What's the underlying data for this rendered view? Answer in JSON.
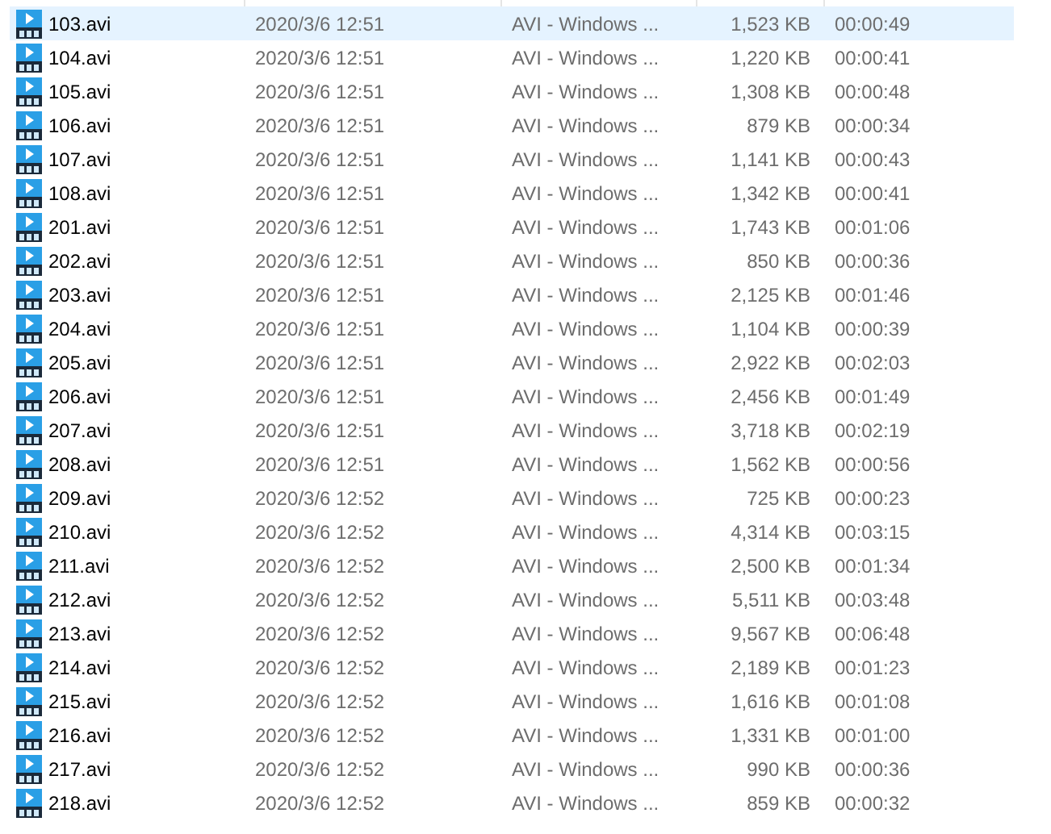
{
  "files": [
    {
      "name": "103.avi",
      "date": "2020/3/6 12:51",
      "type": "AVI - Windows ...",
      "size": "1,523 KB",
      "duration": "00:00:49",
      "selected": true
    },
    {
      "name": "104.avi",
      "date": "2020/3/6 12:51",
      "type": "AVI - Windows ...",
      "size": "1,220 KB",
      "duration": "00:00:41",
      "selected": false
    },
    {
      "name": "105.avi",
      "date": "2020/3/6 12:51",
      "type": "AVI - Windows ...",
      "size": "1,308 KB",
      "duration": "00:00:48",
      "selected": false
    },
    {
      "name": "106.avi",
      "date": "2020/3/6 12:51",
      "type": "AVI - Windows ...",
      "size": "879 KB",
      "duration": "00:00:34",
      "selected": false
    },
    {
      "name": "107.avi",
      "date": "2020/3/6 12:51",
      "type": "AVI - Windows ...",
      "size": "1,141 KB",
      "duration": "00:00:43",
      "selected": false
    },
    {
      "name": "108.avi",
      "date": "2020/3/6 12:51",
      "type": "AVI - Windows ...",
      "size": "1,342 KB",
      "duration": "00:00:41",
      "selected": false
    },
    {
      "name": "201.avi",
      "date": "2020/3/6 12:51",
      "type": "AVI - Windows ...",
      "size": "1,743 KB",
      "duration": "00:01:06",
      "selected": false
    },
    {
      "name": "202.avi",
      "date": "2020/3/6 12:51",
      "type": "AVI - Windows ...",
      "size": "850 KB",
      "duration": "00:00:36",
      "selected": false
    },
    {
      "name": "203.avi",
      "date": "2020/3/6 12:51",
      "type": "AVI - Windows ...",
      "size": "2,125 KB",
      "duration": "00:01:46",
      "selected": false
    },
    {
      "name": "204.avi",
      "date": "2020/3/6 12:51",
      "type": "AVI - Windows ...",
      "size": "1,104 KB",
      "duration": "00:00:39",
      "selected": false
    },
    {
      "name": "205.avi",
      "date": "2020/3/6 12:51",
      "type": "AVI - Windows ...",
      "size": "2,922 KB",
      "duration": "00:02:03",
      "selected": false
    },
    {
      "name": "206.avi",
      "date": "2020/3/6 12:51",
      "type": "AVI - Windows ...",
      "size": "2,456 KB",
      "duration": "00:01:49",
      "selected": false
    },
    {
      "name": "207.avi",
      "date": "2020/3/6 12:51",
      "type": "AVI - Windows ...",
      "size": "3,718 KB",
      "duration": "00:02:19",
      "selected": false
    },
    {
      "name": "208.avi",
      "date": "2020/3/6 12:51",
      "type": "AVI - Windows ...",
      "size": "1,562 KB",
      "duration": "00:00:56",
      "selected": false
    },
    {
      "name": "209.avi",
      "date": "2020/3/6 12:52",
      "type": "AVI - Windows ...",
      "size": "725 KB",
      "duration": "00:00:23",
      "selected": false
    },
    {
      "name": "210.avi",
      "date": "2020/3/6 12:52",
      "type": "AVI - Windows ...",
      "size": "4,314 KB",
      "duration": "00:03:15",
      "selected": false
    },
    {
      "name": "211.avi",
      "date": "2020/3/6 12:52",
      "type": "AVI - Windows ...",
      "size": "2,500 KB",
      "duration": "00:01:34",
      "selected": false
    },
    {
      "name": "212.avi",
      "date": "2020/3/6 12:52",
      "type": "AVI - Windows ...",
      "size": "5,511 KB",
      "duration": "00:03:48",
      "selected": false
    },
    {
      "name": "213.avi",
      "date": "2020/3/6 12:52",
      "type": "AVI - Windows ...",
      "size": "9,567 KB",
      "duration": "00:06:48",
      "selected": false
    },
    {
      "name": "214.avi",
      "date": "2020/3/6 12:52",
      "type": "AVI - Windows ...",
      "size": "2,189 KB",
      "duration": "00:01:23",
      "selected": false
    },
    {
      "name": "215.avi",
      "date": "2020/3/6 12:52",
      "type": "AVI - Windows ...",
      "size": "1,616 KB",
      "duration": "00:01:08",
      "selected": false
    },
    {
      "name": "216.avi",
      "date": "2020/3/6 12:52",
      "type": "AVI - Windows ...",
      "size": "1,331 KB",
      "duration": "00:01:00",
      "selected": false
    },
    {
      "name": "217.avi",
      "date": "2020/3/6 12:52",
      "type": "AVI - Windows ...",
      "size": "990 KB",
      "duration": "00:00:36",
      "selected": false
    },
    {
      "name": "218.avi",
      "date": "2020/3/6 12:52",
      "type": "AVI - Windows ...",
      "size": "859 KB",
      "duration": "00:00:32",
      "selected": false
    }
  ]
}
